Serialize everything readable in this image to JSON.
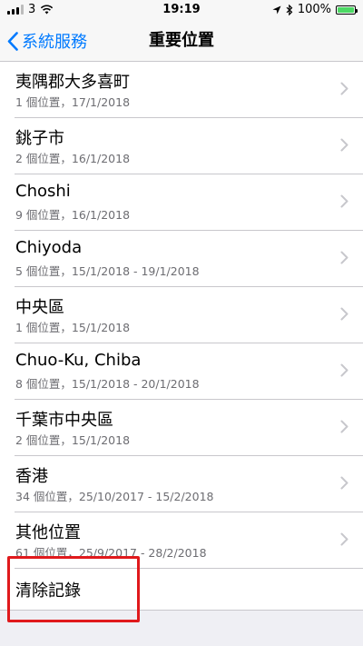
{
  "status_bar": {
    "carrier": "3",
    "time": "19:19",
    "battery_percent": "100%",
    "battery_color": "#4cd964"
  },
  "nav": {
    "back_label": "系統服務",
    "title": "重要位置"
  },
  "locations": [
    {
      "title": "夷隅郡大多喜町",
      "subtitle": "1 個位置，17/1/2018"
    },
    {
      "title": "銚子市",
      "subtitle": "2 個位置，16/1/2018"
    },
    {
      "title": "Choshi",
      "subtitle": "9 個位置，16/1/2018"
    },
    {
      "title": "Chiyoda",
      "subtitle": "5 個位置，15/1/2018 - 19/1/2018"
    },
    {
      "title": "中央區",
      "subtitle": "1 個位置，15/1/2018"
    },
    {
      "title": "Chuo-Ku, Chiba",
      "subtitle": "8 個位置，15/1/2018 - 20/1/2018"
    },
    {
      "title": "千葉市中央區",
      "subtitle": "2 個位置，15/1/2018"
    },
    {
      "title": "香港",
      "subtitle": "34 個位置，25/10/2017 - 15/2/2018"
    },
    {
      "title": "其他位置",
      "subtitle": "61 個位置，25/9/2017 - 28/2/2018"
    }
  ],
  "clear_history": {
    "label": "清除記錄",
    "highlight_color": "#e0191c"
  },
  "colors": {
    "accent": "#007aff",
    "background": "#efeff4"
  }
}
